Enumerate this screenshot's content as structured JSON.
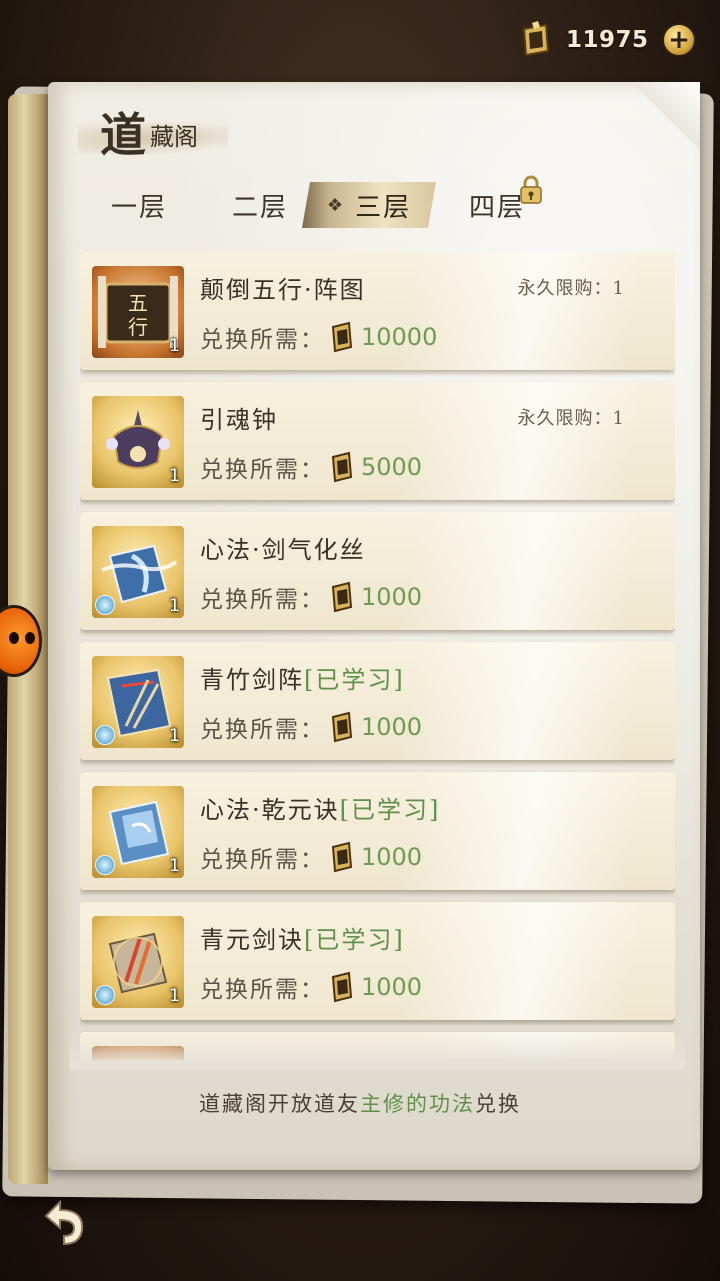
{
  "currency": {
    "amount": "11975",
    "plus": "+",
    "icon": "token-icon"
  },
  "header": {
    "title_big": "道",
    "title_small": "藏阁"
  },
  "tabs": [
    {
      "label": "一层",
      "active": false,
      "locked": false
    },
    {
      "label": "二层",
      "active": false,
      "locked": false
    },
    {
      "label": "三层",
      "active": true,
      "locked": false
    },
    {
      "label": "四层",
      "active": false,
      "locked": true
    }
  ],
  "active_marker": "❖",
  "items": [
    {
      "name": "颠倒五行·阵图",
      "learned": "",
      "limit": "永久限购：1",
      "cost_label": "兑换所需：",
      "cost": "10000",
      "count": "1",
      "thumb": "orange",
      "tier": false
    },
    {
      "name": "引魂钟",
      "learned": "",
      "limit": "永久限购：1",
      "cost_label": "兑换所需：",
      "cost": "5000",
      "count": "1",
      "thumb": "gold",
      "tier": false
    },
    {
      "name": "心法·剑气化丝",
      "learned": "",
      "limit": "",
      "cost_label": "兑换所需：",
      "cost": "1000",
      "count": "1",
      "thumb": "gold",
      "tier": true
    },
    {
      "name": "青竹剑阵",
      "learned": "[已学习]",
      "limit": "",
      "cost_label": "兑换所需：",
      "cost": "1000",
      "count": "1",
      "thumb": "gold",
      "tier": true
    },
    {
      "name": "心法·乾元诀",
      "learned": "[已学习]",
      "limit": "",
      "cost_label": "兑换所需：",
      "cost": "1000",
      "count": "1",
      "thumb": "gold",
      "tier": true
    },
    {
      "name": "青元剑诀",
      "learned": "[已学习]",
      "limit": "",
      "cost_label": "兑换所需：",
      "cost": "1000",
      "count": "1",
      "thumb": "gold",
      "tier": true
    }
  ],
  "footer": {
    "pre": "道藏阁开放道友",
    "highlight": "主修的功法",
    "post": "兑换"
  }
}
